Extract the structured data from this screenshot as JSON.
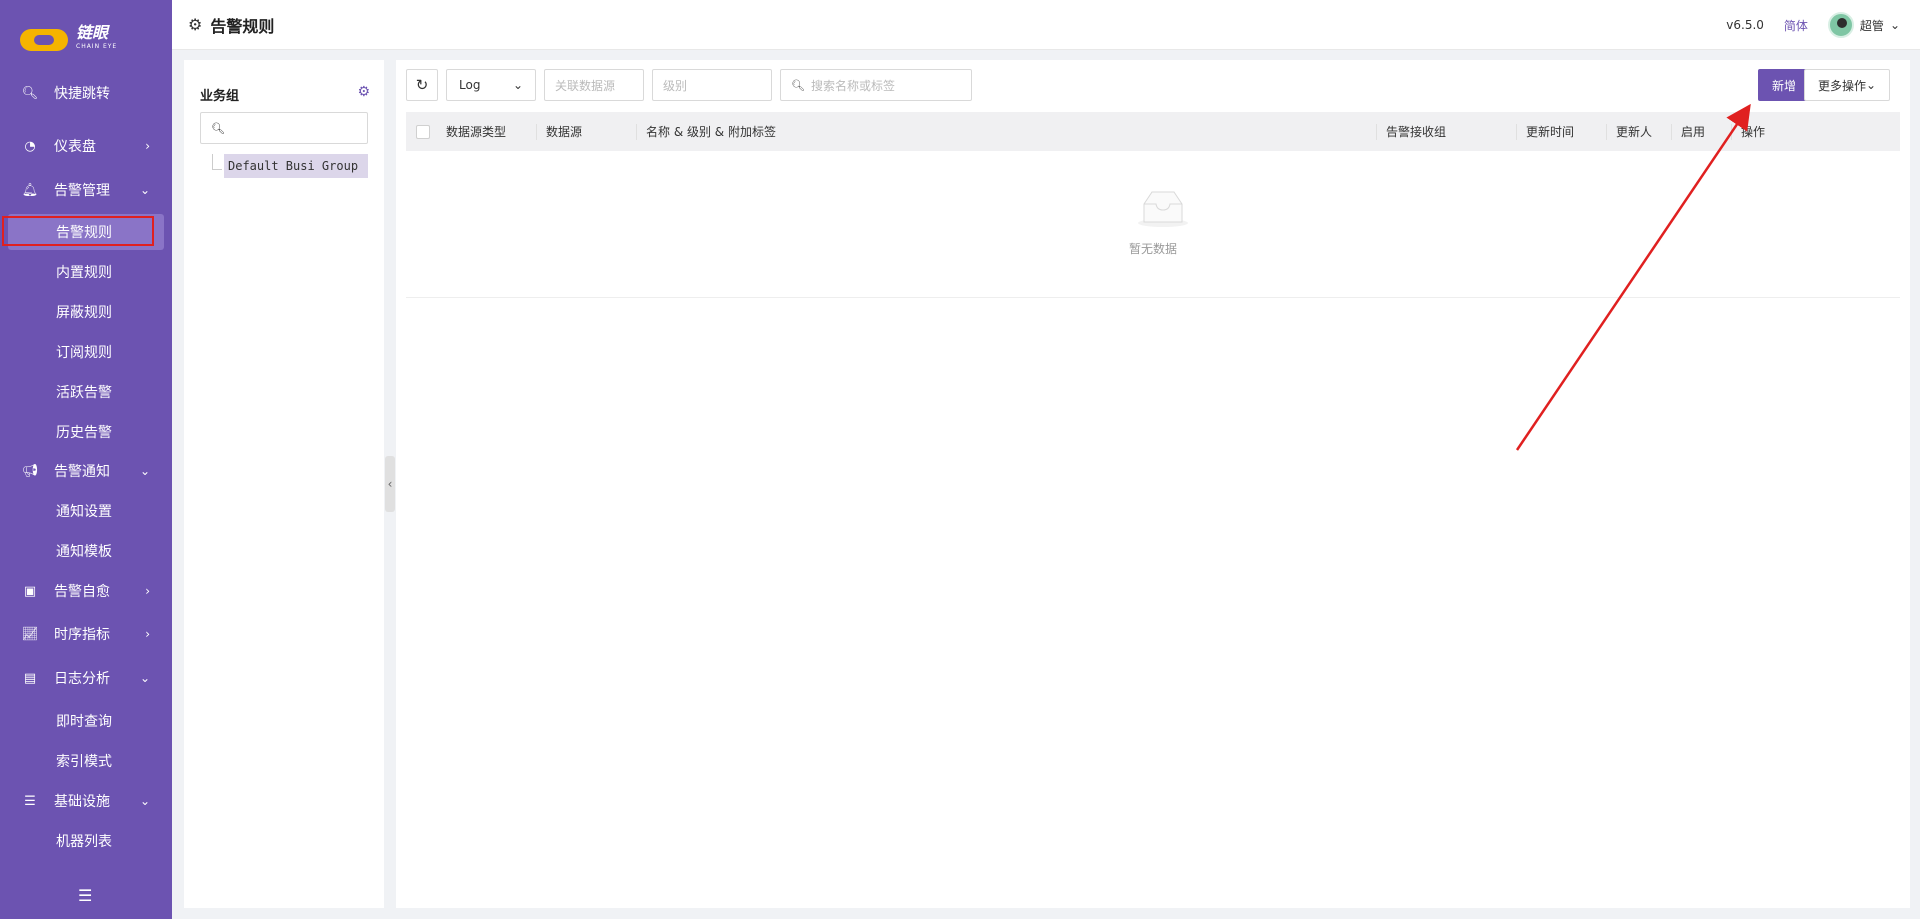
{
  "brand": {
    "name": "链眼",
    "sub": "CHAIN EYE"
  },
  "sidebar": {
    "items": [
      {
        "label": "快捷跳转",
        "icon": "search-icon",
        "type": "item"
      },
      {
        "label": "仪表盘",
        "icon": "dashboard-icon",
        "type": "group",
        "chevron": "right"
      },
      {
        "label": "告警管理",
        "icon": "alarm-icon",
        "type": "group",
        "chevron": "down"
      },
      {
        "label": "告警规则",
        "type": "sub",
        "active": true
      },
      {
        "label": "内置规则",
        "type": "sub"
      },
      {
        "label": "屏蔽规则",
        "type": "sub"
      },
      {
        "label": "订阅规则",
        "type": "sub"
      },
      {
        "label": "活跃告警",
        "type": "sub"
      },
      {
        "label": "历史告警",
        "type": "sub"
      },
      {
        "label": "告警通知",
        "icon": "megaphone-icon",
        "type": "group",
        "chevron": "down"
      },
      {
        "label": "通知设置",
        "type": "sub"
      },
      {
        "label": "通知模板",
        "type": "sub"
      },
      {
        "label": "告警自愈",
        "icon": "terminal-icon",
        "type": "group",
        "chevron": "right"
      },
      {
        "label": "时序指标",
        "icon": "line-chart-icon",
        "type": "group",
        "chevron": "right"
      },
      {
        "label": "日志分析",
        "icon": "log-icon",
        "type": "group",
        "chevron": "down"
      },
      {
        "label": "即时查询",
        "type": "sub"
      },
      {
        "label": "索引模式",
        "type": "sub"
      },
      {
        "label": "基础设施",
        "icon": "server-icon",
        "type": "group",
        "chevron": "down"
      },
      {
        "label": "机器列表",
        "type": "sub"
      }
    ]
  },
  "header": {
    "title": "告警规则",
    "version": "v6.5.0",
    "language": "简体",
    "user": "超管"
  },
  "left_panel": {
    "title": "业务组",
    "search_placeholder": "",
    "tree": [
      {
        "label": "Default Busi Group",
        "selected": true
      }
    ]
  },
  "toolbar": {
    "datasource_type": "Log",
    "datasource_placeholder": "关联数据源",
    "level_placeholder": "级别",
    "search_placeholder": "搜索名称或标签",
    "add_label": "新增",
    "more_label": "更多操作"
  },
  "table": {
    "columns": [
      "数据源类型",
      "数据源",
      "名称 & 级别 & 附加标签",
      "告警接收组",
      "更新时间",
      "更新人",
      "启用",
      "操作"
    ],
    "rows": [],
    "empty_text": "暂无数据"
  },
  "colors": {
    "accent": "#6c53b1",
    "highlight": "#e02020"
  }
}
